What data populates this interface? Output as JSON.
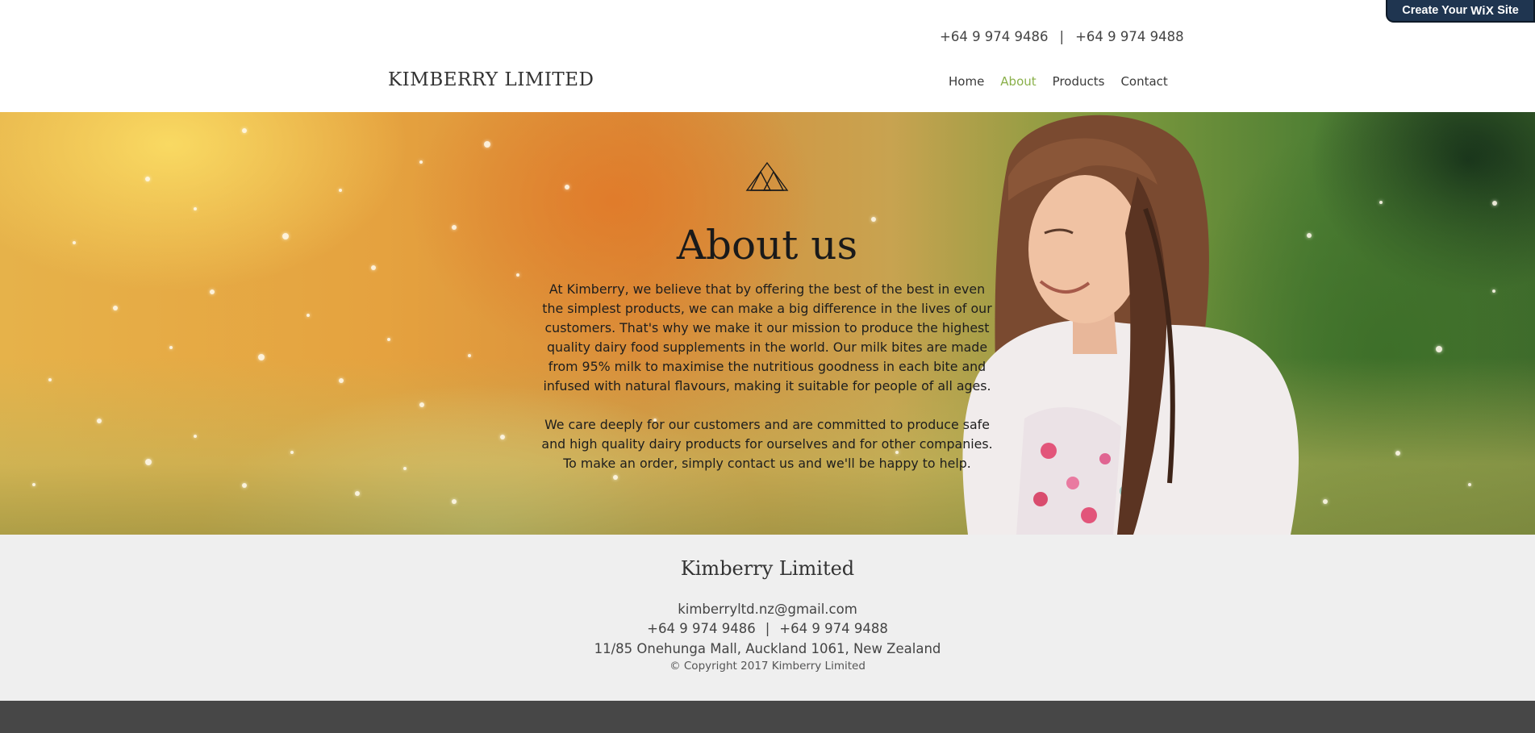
{
  "wix_banner": {
    "prefix": "Create Your",
    "brand": "WiX",
    "suffix": "Site"
  },
  "topbar": {
    "phone1": "+64 9 974 9486",
    "separator": "|",
    "phone2": "+64 9 974 9488"
  },
  "header": {
    "logo": "KIMBERRY LIMITED",
    "nav": [
      {
        "label": "Home",
        "active": false
      },
      {
        "label": "About",
        "active": true
      },
      {
        "label": "Products",
        "active": false
      },
      {
        "label": "Contact",
        "active": false
      }
    ]
  },
  "hero": {
    "title": "About us",
    "paragraph1": "At Kimberry, we believe that by offering the best of the best in even the simplest products, we can make a big difference in the lives of our customers. That's why we make it our mission to produce the highest quality dairy food supplements in the world.  Our milk bites are made from 95% milk to maximise the nutritious goodness in each bite and infused with natural flavours, making it suitable for people of all ages.",
    "paragraph2": "We care deeply for our customers and are committed to produce safe and high quality dairy products for ourselves and for other companies. To make an order, simply contact us and we'll be happy to help."
  },
  "footer": {
    "title": "Kimberry Limited",
    "email": "kimberryltd.nz@gmail.com",
    "phone1": "+64 9 974 9486",
    "separator": "|",
    "phone2": "+64 9 974 9488",
    "address": "11/85 Onehunga Mall, Auckland 1061, New Zealand",
    "copyright": "© Copyright 2017 Kimberry Limited"
  },
  "colors": {
    "accent": "#8ab04a",
    "wix_banner": "#1f3550",
    "footer_bg": "#efefef",
    "bottom_bar": "#474747"
  }
}
